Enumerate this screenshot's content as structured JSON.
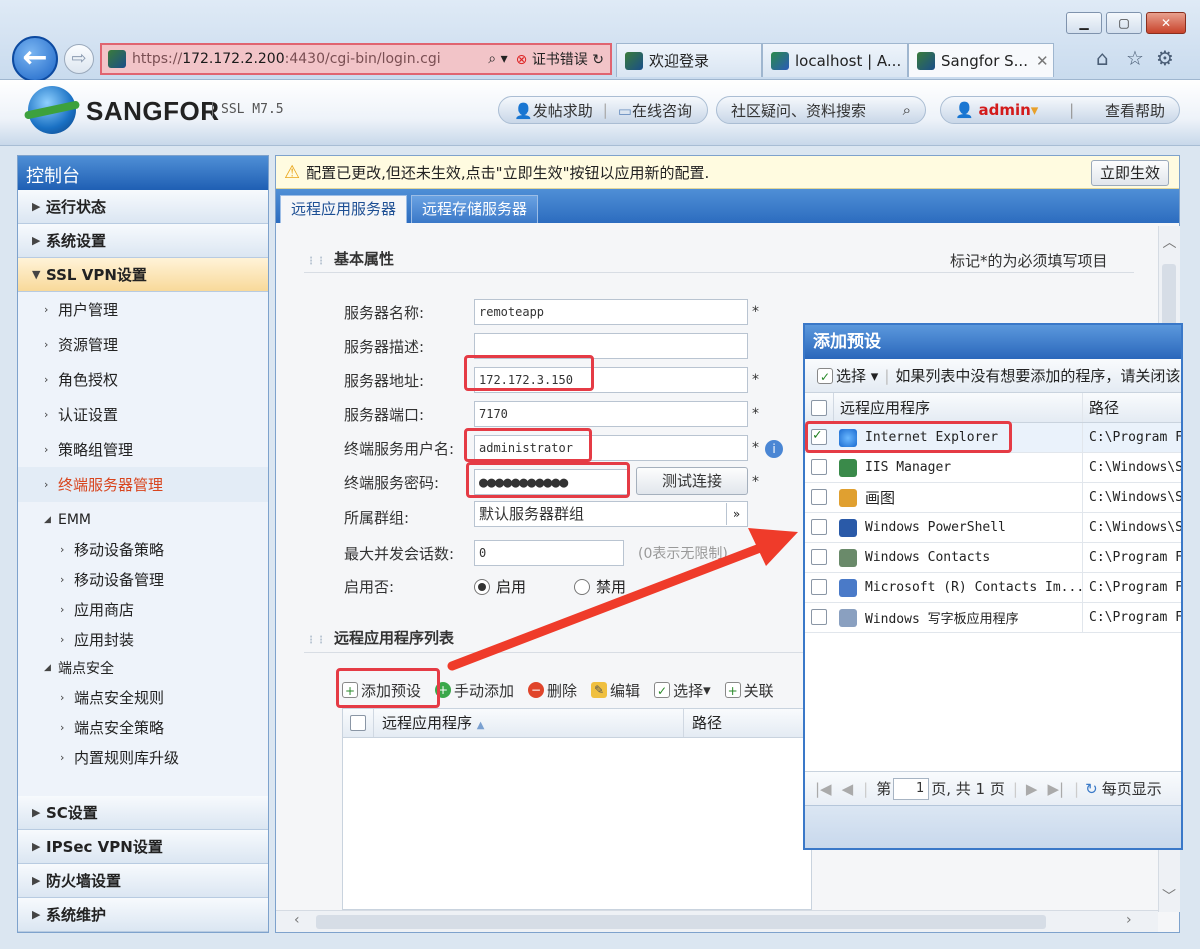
{
  "browser": {
    "url_prefix": "https://",
    "url_host": "172.172.2.200",
    "url_rest": ":4430/cgi-bin/login.cgi",
    "cert_error": "证书错误",
    "tabs": [
      {
        "label": "欢迎登录"
      },
      {
        "label": "localhost | A..."
      },
      {
        "label": "Sangfor S..."
      }
    ]
  },
  "header": {
    "brand": "SANGFOR",
    "version": "SSL M7.5",
    "post_help": "发帖求助",
    "online_consult": "在线咨询",
    "community_search": "社区疑问、资料搜索",
    "user": "admin",
    "view_help": "查看帮助"
  },
  "sidebar": {
    "title": "控制台",
    "sec_status": "运行状态",
    "sec_system": "系统设置",
    "sec_sslvpn": "SSL VPN设置",
    "items": [
      "用户管理",
      "资源管理",
      "角色授权",
      "认证设置",
      "策略组管理",
      "终端服务器管理"
    ],
    "emm": "EMM",
    "emm_items": [
      "移动设备策略",
      "移动设备管理",
      "应用商店",
      "应用封装"
    ],
    "endpoint": "端点安全",
    "endpoint_items": [
      "端点安全规则",
      "端点安全策略",
      "内置规则库升级"
    ],
    "sec_sc": "SC设置",
    "sec_ipsec": "IPSec VPN设置",
    "sec_firewall": "防火墙设置",
    "sec_maint": "系统维护"
  },
  "notice": {
    "text": "配置已更改,但还未生效,点击\"立即生效\"按钮以应用新的配置.",
    "apply": "立即生效"
  },
  "tabs": [
    "远程应用服务器",
    "远程存储服务器"
  ],
  "form": {
    "section_title": "基本属性",
    "required_note": "标记*的为必须填写项目",
    "server_name_label": "服务器名称:",
    "server_name": "remoteapp",
    "server_desc_label": "服务器描述:",
    "server_desc": "",
    "server_addr_label": "服务器地址:",
    "server_addr": "172.172.3.150",
    "server_port_label": "服务器端口:",
    "server_port": "7170",
    "term_user_label": "终端服务用户名:",
    "term_user": "administrator",
    "term_pass_label": "终端服务密码:",
    "term_pass": "●●●●●●●●●●●",
    "test_btn": "测试连接",
    "group_label": "所属群组:",
    "group": "默认服务器群组",
    "max_sess_label": "最大并发会话数:",
    "max_sess": "0",
    "max_sess_hint": "(0表示无限制)",
    "enable_label": "启用否:",
    "enable_on": "启用",
    "enable_off": "禁用",
    "star": "*"
  },
  "applist": {
    "section_title": "远程应用程序列表",
    "add_preset": "添加预设",
    "manual_add": "手动添加",
    "delete": "删除",
    "edit": "编辑",
    "select": "选择",
    "close": "关联",
    "col_app": "远程应用程序",
    "col_path": "路径"
  },
  "dialog": {
    "title": "添加预设",
    "select": "选择",
    "hint": "如果列表中没有想要添加的程序，请关闭该",
    "col_app": "远程应用程序",
    "col_path": "路径",
    "rows": [
      {
        "name": "Internet Explorer",
        "path": "C:\\Program Files",
        "checked": true,
        "color": "#2a7fd8"
      },
      {
        "name": "IIS Manager",
        "path": "C:\\Windows\\Sys",
        "checked": false,
        "color": "#3a8a4a"
      },
      {
        "name": "画图",
        "path": "C:\\Windows\\Sys",
        "checked": false,
        "color": "#e0a030"
      },
      {
        "name": "Windows PowerShell",
        "path": "C:\\Windows\\Sys",
        "checked": false,
        "color": "#2a5aa8"
      },
      {
        "name": "Windows Contacts",
        "path": "C:\\Program Files",
        "checked": false,
        "color": "#6a8a6a"
      },
      {
        "name": "Microsoft (R) Contacts Im...",
        "path": "C:\\Program Files",
        "checked": false,
        "color": "#4a7ac8"
      },
      {
        "name": "Windows 写字板应用程序",
        "path": "C:\\Program Files",
        "checked": false,
        "color": "#8aa0c0"
      }
    ],
    "pager_page_label": "第",
    "pager_page": "1",
    "pager_total": "页, 共 1 页",
    "per_page": "每页显示"
  }
}
